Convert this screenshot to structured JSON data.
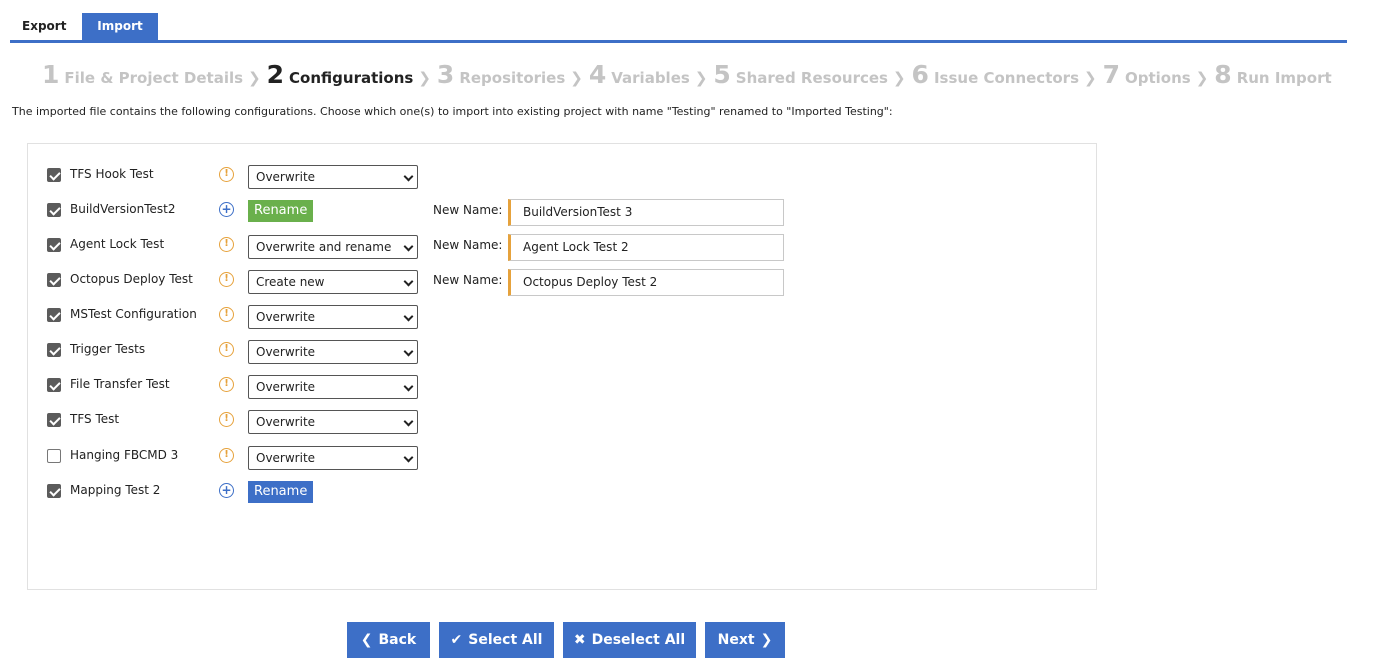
{
  "tabs": {
    "export": "Export",
    "import": "Import"
  },
  "wizard": {
    "steps": [
      {
        "num": "1",
        "label": "File & Project Details"
      },
      {
        "num": "2",
        "label": "Configurations"
      },
      {
        "num": "3",
        "label": "Repositories"
      },
      {
        "num": "4",
        "label": "Variables"
      },
      {
        "num": "5",
        "label": "Shared Resources"
      },
      {
        "num": "6",
        "label": "Issue Connectors"
      },
      {
        "num": "7",
        "label": "Options"
      },
      {
        "num": "8",
        "label": "Run Import"
      }
    ],
    "active_step": "2"
  },
  "intro_text": "The imported file contains the following configurations. Choose which one(s) to import into existing project with name \"Testing\" renamed to \"Imported Testing\":",
  "new_name_label": "New Name:",
  "configurations": [
    {
      "name": "TFS Hook Test",
      "checked": true,
      "action": "Overwrite"
    },
    {
      "name": "BuildVersionTest2",
      "checked": true,
      "action": "Rename",
      "new_name": "BuildVersionTest 3"
    },
    {
      "name": "Agent Lock Test",
      "checked": true,
      "action": "Overwrite and rename",
      "new_name": "Agent Lock Test 2"
    },
    {
      "name": "Octopus Deploy Test",
      "checked": true,
      "action": "Create new",
      "new_name": "Octopus Deploy Test 2"
    },
    {
      "name": "MSTest Configuration",
      "checked": true,
      "action": "Overwrite"
    },
    {
      "name": "Trigger Tests",
      "checked": true,
      "action": "Overwrite"
    },
    {
      "name": "File Transfer Test",
      "checked": true,
      "action": "Overwrite"
    },
    {
      "name": "TFS Test",
      "checked": true,
      "action": "Overwrite"
    },
    {
      "name": "Hanging FBCMD 3",
      "checked": false,
      "action": "Overwrite"
    },
    {
      "name": "Mapping Test 2",
      "checked": true,
      "action": "Rename"
    }
  ],
  "buttons": {
    "back": "Back",
    "select_all": "Select All",
    "deselect_all": "Deselect All",
    "next": "Next"
  },
  "colors": {
    "primary": "#3d6fc7",
    "rename_active": "#6ab04c",
    "warning": "#e6a23c"
  }
}
